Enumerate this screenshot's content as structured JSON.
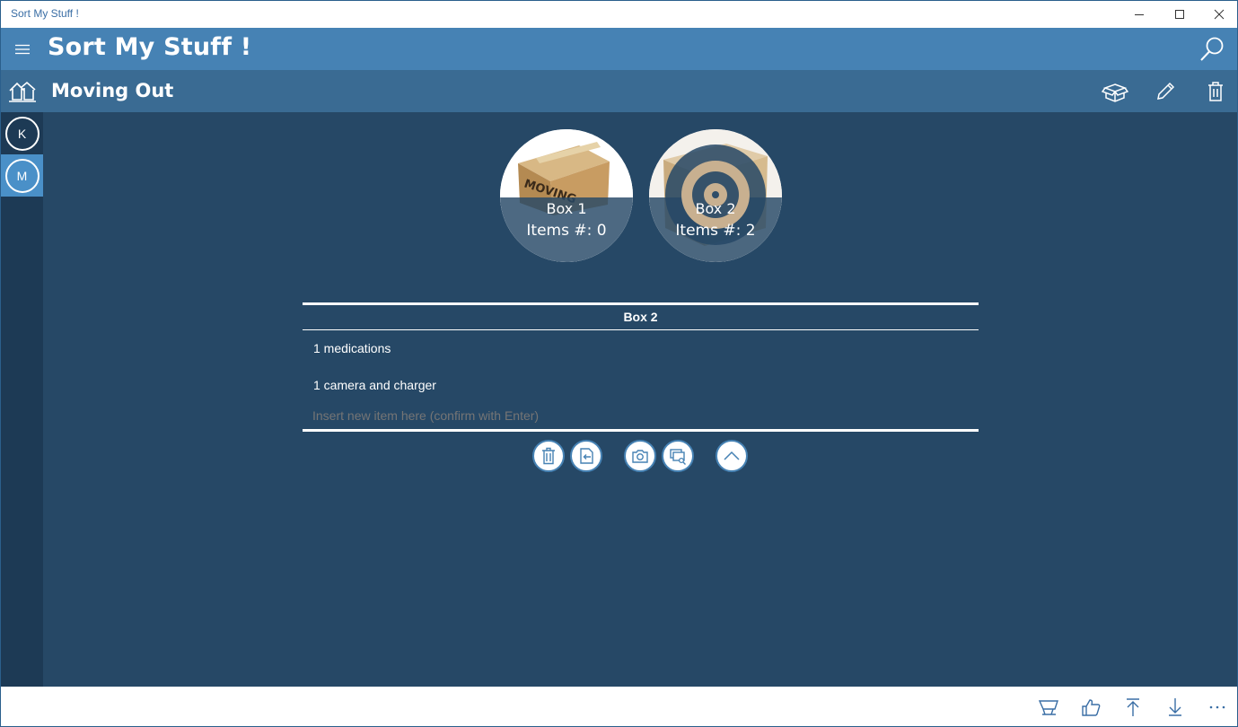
{
  "window": {
    "title": "Sort My Stuff !"
  },
  "header": {
    "app_title": "Sort My Stuff !"
  },
  "rail": {
    "items": [
      {
        "label": "K"
      },
      {
        "label": "M",
        "active": true
      }
    ]
  },
  "collection": {
    "title": "Moving Out"
  },
  "boxes": [
    {
      "name": "Box 1",
      "count_label": "Items #: 0"
    },
    {
      "name": "Box 2",
      "count_label": "Items #: 2"
    }
  ],
  "box_detail": {
    "title": "Box 2",
    "items": [
      {
        "text": "1 medications"
      },
      {
        "text": "1 camera and charger"
      }
    ],
    "new_item_placeholder": "Insert new item here (confirm with Enter)"
  },
  "colors": {
    "header": "#4682b4",
    "subheader": "#3a6b93",
    "main": "#264866",
    "rail": "#1d3a55"
  }
}
